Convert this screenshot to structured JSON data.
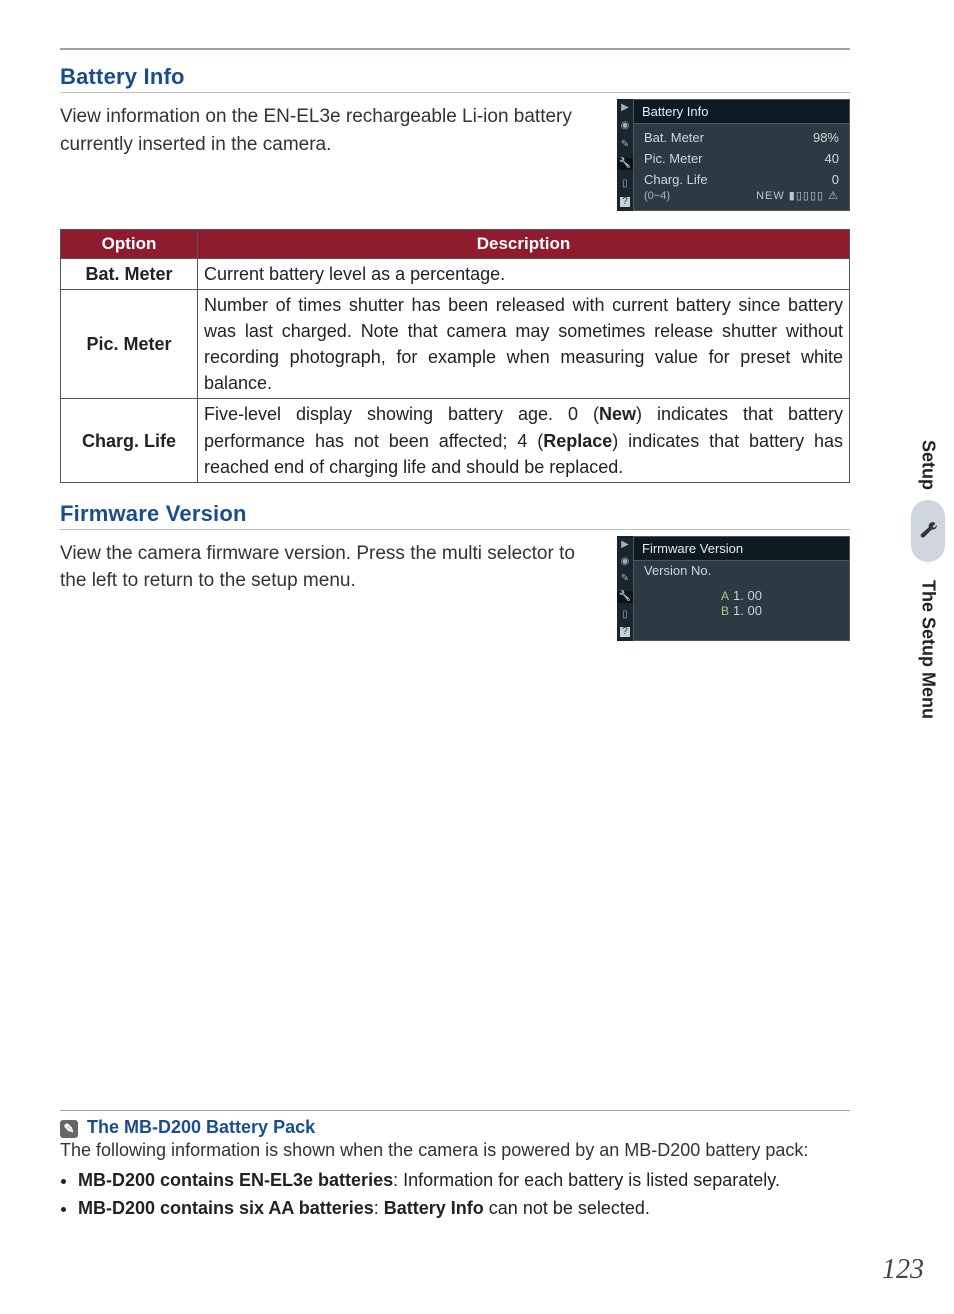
{
  "section1": {
    "title": "Battery Info",
    "intro": "View information on the EN-EL3e rechargeable Li-ion battery currently inserted in the camera."
  },
  "lcd1": {
    "title": "Battery Info",
    "r1_label": "Bat. Meter",
    "r1_val": "98%",
    "r2_label": "Pic. Meter",
    "r2_val": "40",
    "r3_label": "Charg. Life",
    "r3_sub": "(0~4)",
    "r3_val": "0",
    "gauge_left": "NEW"
  },
  "table": {
    "h1": "Option",
    "h2": "Description",
    "rows": [
      {
        "opt": "Bat. Meter",
        "desc": "Current battery level as a percentage."
      },
      {
        "opt": "Pic. Meter",
        "desc": "Number of times shutter has been released with current battery since battery was last charged.  Note that camera may sometimes release shutter without recording photograph, for example when measuring value for preset white balance."
      },
      {
        "opt": "Charg. Life",
        "desc_pre": "Five-level display showing battery age.  0 (",
        "desc_b1": "New",
        "desc_mid": ") indicates that battery performance has not been affected; 4 (",
        "desc_b2": "Replace",
        "desc_post": ") indicates that battery has reached end of charging life and should be replaced."
      }
    ]
  },
  "section2": {
    "title": "Firmware Version",
    "intro": "View the camera firmware version.  Press the multi selector to the left to return to the setup menu."
  },
  "lcd2": {
    "title": "Firmware Version",
    "subtitle": "Version No.",
    "a_label": "A",
    "a_val": "1. 00",
    "b_label": "B",
    "b_val": "1. 00"
  },
  "note": {
    "title": "The MB-D200 Battery Pack",
    "body": "The following information is shown when the camera is powered by an MB-D200 battery pack:",
    "li1_b": "MB-D200 contains EN-EL3e batteries",
    "li1_t": ": Information for each battery is listed separately.",
    "li2_b1": "MB-D200 contains six AA batteries",
    "li2_mid": ": ",
    "li2_b2": "Battery Info",
    "li2_t": " can not be selected."
  },
  "side": {
    "label_top": "Setup",
    "label_bottom": "The Setup Menu"
  },
  "page_number": "123"
}
